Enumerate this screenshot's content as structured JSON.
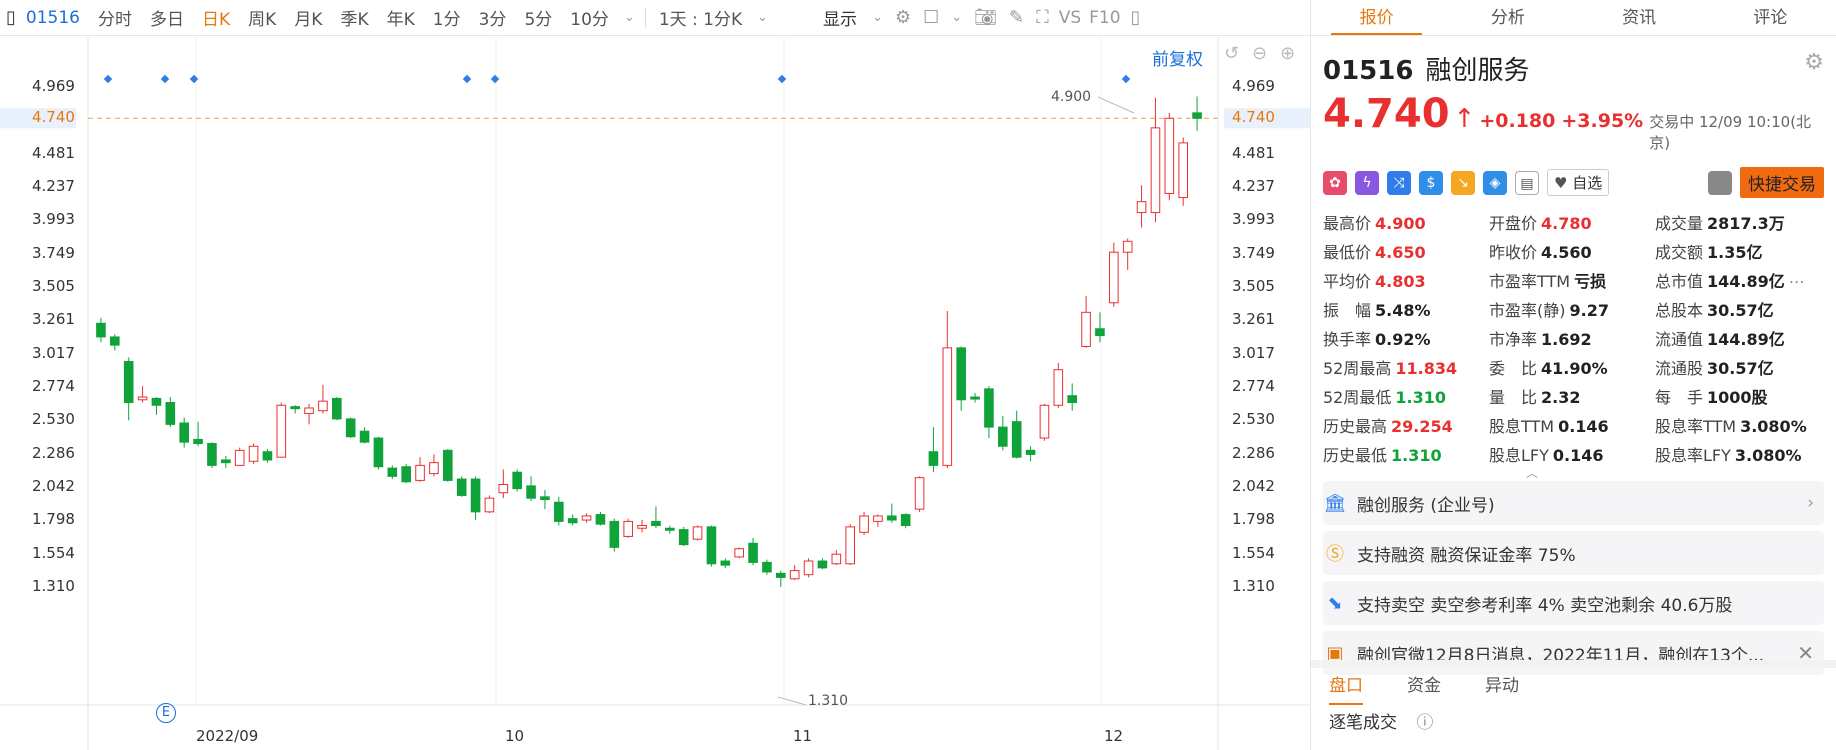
{
  "toolbar": {
    "code": "01516",
    "periods": [
      "分时",
      "多日",
      "日K",
      "周K",
      "月K",
      "季K",
      "年K",
      "1分",
      "3分",
      "5分",
      "10分"
    ],
    "active_period": "日K",
    "interval_select": "1天 : 1分K",
    "display_label": "显示",
    "vs_label": "VS",
    "f10_label": "F10"
  },
  "chart": {
    "adjust_label": "前复权",
    "current_price_label": "4.740",
    "y_ticks": [
      "4.969",
      "4.740",
      "4.481",
      "4.237",
      "3.993",
      "3.749",
      "3.505",
      "3.261",
      "3.017",
      "2.774",
      "2.530",
      "2.286",
      "2.042",
      "1.798",
      "1.554",
      "1.310"
    ],
    "x_ticks": [
      "2022/09",
      "10",
      "11",
      "12"
    ],
    "high_marker": "4.900",
    "low_marker": "1.310",
    "event_marker": "E"
  },
  "chart_data": {
    "type": "candlestick",
    "y_range": [
      1.31,
      4.969
    ],
    "candles": [
      {
        "o": 3.24,
        "c": 3.14,
        "h": 3.28,
        "l": 3.1
      },
      {
        "o": 3.14,
        "c": 3.08,
        "h": 3.16,
        "l": 3.04
      },
      {
        "o": 2.96,
        "c": 2.66,
        "h": 2.99,
        "l": 2.53
      },
      {
        "o": 2.68,
        "c": 2.7,
        "h": 2.78,
        "l": 2.66
      },
      {
        "o": 2.69,
        "c": 2.64,
        "h": 2.7,
        "l": 2.57
      },
      {
        "o": 2.66,
        "c": 2.5,
        "h": 2.7,
        "l": 2.48
      },
      {
        "o": 2.51,
        "c": 2.37,
        "h": 2.55,
        "l": 2.33
      },
      {
        "o": 2.39,
        "c": 2.36,
        "h": 2.52,
        "l": 2.34
      },
      {
        "o": 2.36,
        "c": 2.2,
        "h": 2.37,
        "l": 2.18
      },
      {
        "o": 2.24,
        "c": 2.22,
        "h": 2.27,
        "l": 2.18
      },
      {
        "o": 2.2,
        "c": 2.31,
        "h": 2.33,
        "l": 2.2
      },
      {
        "o": 2.23,
        "c": 2.34,
        "h": 2.36,
        "l": 2.21
      },
      {
        "o": 2.3,
        "c": 2.24,
        "h": 2.32,
        "l": 2.22
      },
      {
        "o": 2.26,
        "c": 2.64,
        "h": 2.66,
        "l": 2.26
      },
      {
        "o": 2.63,
        "c": 2.62,
        "h": 2.64,
        "l": 2.58
      },
      {
        "o": 2.58,
        "c": 2.62,
        "h": 2.65,
        "l": 2.5
      },
      {
        "o": 2.6,
        "c": 2.67,
        "h": 2.79,
        "l": 2.58
      },
      {
        "o": 2.69,
        "c": 2.54,
        "h": 2.7,
        "l": 2.53
      },
      {
        "o": 2.54,
        "c": 2.41,
        "h": 2.55,
        "l": 2.4
      },
      {
        "o": 2.45,
        "c": 2.37,
        "h": 2.48,
        "l": 2.36
      },
      {
        "o": 2.4,
        "c": 2.19,
        "h": 2.41,
        "l": 2.17
      },
      {
        "o": 2.18,
        "c": 2.12,
        "h": 2.2,
        "l": 2.1
      },
      {
        "o": 2.19,
        "c": 2.08,
        "h": 2.21,
        "l": 2.07
      },
      {
        "o": 2.09,
        "c": 2.2,
        "h": 2.26,
        "l": 2.08
      },
      {
        "o": 2.14,
        "c": 2.22,
        "h": 2.28,
        "l": 2.12
      },
      {
        "o": 2.31,
        "c": 2.09,
        "h": 2.32,
        "l": 2.08
      },
      {
        "o": 2.1,
        "c": 1.98,
        "h": 2.12,
        "l": 1.97
      },
      {
        "o": 2.1,
        "c": 1.86,
        "h": 2.12,
        "l": 1.8
      },
      {
        "o": 1.86,
        "c": 1.96,
        "h": 1.98,
        "l": 1.85
      },
      {
        "o": 2.0,
        "c": 2.06,
        "h": 2.17,
        "l": 1.96
      },
      {
        "o": 2.15,
        "c": 2.03,
        "h": 2.17,
        "l": 2.01
      },
      {
        "o": 2.05,
        "c": 1.96,
        "h": 2.12,
        "l": 1.94
      },
      {
        "o": 1.97,
        "c": 1.95,
        "h": 2.02,
        "l": 1.88
      },
      {
        "o": 1.93,
        "c": 1.79,
        "h": 1.97,
        "l": 1.76
      },
      {
        "o": 1.81,
        "c": 1.78,
        "h": 1.84,
        "l": 1.76
      },
      {
        "o": 1.8,
        "c": 1.83,
        "h": 1.85,
        "l": 1.78
      },
      {
        "o": 1.84,
        "c": 1.77,
        "h": 1.86,
        "l": 1.76
      },
      {
        "o": 1.79,
        "c": 1.6,
        "h": 1.81,
        "l": 1.57
      },
      {
        "o": 1.68,
        "c": 1.79,
        "h": 1.81,
        "l": 1.67
      },
      {
        "o": 1.74,
        "c": 1.76,
        "h": 1.8,
        "l": 1.71
      },
      {
        "o": 1.79,
        "c": 1.76,
        "h": 1.9,
        "l": 1.74
      },
      {
        "o": 1.74,
        "c": 1.73,
        "h": 1.76,
        "l": 1.7
      },
      {
        "o": 1.73,
        "c": 1.62,
        "h": 1.75,
        "l": 1.61
      },
      {
        "o": 1.66,
        "c": 1.75,
        "h": 1.76,
        "l": 1.65
      },
      {
        "o": 1.75,
        "c": 1.48,
        "h": 1.76,
        "l": 1.46
      },
      {
        "o": 1.5,
        "c": 1.47,
        "h": 1.52,
        "l": 1.45
      },
      {
        "o": 1.53,
        "c": 1.59,
        "h": 1.6,
        "l": 1.52
      },
      {
        "o": 1.63,
        "c": 1.49,
        "h": 1.67,
        "l": 1.47
      },
      {
        "o": 1.49,
        "c": 1.42,
        "h": 1.51,
        "l": 1.4
      },
      {
        "o": 1.41,
        "c": 1.38,
        "h": 1.43,
        "l": 1.31
      },
      {
        "o": 1.37,
        "c": 1.43,
        "h": 1.47,
        "l": 1.36
      },
      {
        "o": 1.4,
        "c": 1.5,
        "h": 1.52,
        "l": 1.38
      },
      {
        "o": 1.5,
        "c": 1.45,
        "h": 1.52,
        "l": 1.44
      },
      {
        "o": 1.48,
        "c": 1.55,
        "h": 1.58,
        "l": 1.47
      },
      {
        "o": 1.48,
        "c": 1.75,
        "h": 1.77,
        "l": 1.47
      },
      {
        "o": 1.71,
        "c": 1.83,
        "h": 1.86,
        "l": 1.69
      },
      {
        "o": 1.79,
        "c": 1.83,
        "h": 1.84,
        "l": 1.75
      },
      {
        "o": 1.83,
        "c": 1.8,
        "h": 1.92,
        "l": 1.78
      },
      {
        "o": 1.84,
        "c": 1.76,
        "h": 1.85,
        "l": 1.74
      },
      {
        "o": 1.88,
        "c": 2.11,
        "h": 2.12,
        "l": 1.86
      },
      {
        "o": 2.3,
        "c": 2.2,
        "h": 2.48,
        "l": 2.15
      },
      {
        "o": 2.2,
        "c": 3.06,
        "h": 3.33,
        "l": 2.18
      },
      {
        "o": 3.06,
        "c": 2.68,
        "h": 3.07,
        "l": 2.6
      },
      {
        "o": 2.7,
        "c": 2.69,
        "h": 2.73,
        "l": 2.66
      },
      {
        "o": 2.76,
        "c": 2.48,
        "h": 2.78,
        "l": 2.4
      },
      {
        "o": 2.48,
        "c": 2.34,
        "h": 2.56,
        "l": 2.31
      },
      {
        "o": 2.52,
        "c": 2.26,
        "h": 2.6,
        "l": 2.25
      },
      {
        "o": 2.31,
        "c": 2.28,
        "h": 2.34,
        "l": 2.23
      },
      {
        "o": 2.4,
        "c": 2.64,
        "h": 2.65,
        "l": 2.38
      },
      {
        "o": 2.64,
        "c": 2.9,
        "h": 2.95,
        "l": 2.62
      },
      {
        "o": 2.71,
        "c": 2.66,
        "h": 2.8,
        "l": 2.6
      },
      {
        "o": 3.07,
        "c": 3.32,
        "h": 3.44,
        "l": 3.06
      },
      {
        "o": 3.2,
        "c": 3.15,
        "h": 3.32,
        "l": 3.1
      },
      {
        "o": 3.39,
        "c": 3.76,
        "h": 3.83,
        "l": 3.36
      },
      {
        "o": 3.76,
        "c": 3.84,
        "h": 3.86,
        "l": 3.63
      },
      {
        "o": 4.05,
        "c": 4.13,
        "h": 4.25,
        "l": 3.94
      },
      {
        "o": 4.05,
        "c": 4.67,
        "h": 4.89,
        "l": 3.98
      },
      {
        "o": 4.19,
        "c": 4.74,
        "h": 4.78,
        "l": 4.14
      },
      {
        "o": 4.16,
        "c": 4.56,
        "h": 4.6,
        "l": 4.1
      },
      {
        "o": 4.78,
        "c": 4.74,
        "h": 4.9,
        "l": 4.65
      }
    ]
  },
  "tabs": [
    "报价",
    "分析",
    "资讯",
    "评论"
  ],
  "active_tab": "报价",
  "quote": {
    "code": "01516",
    "name": "融创服务",
    "price": "4.740",
    "change": "+0.180",
    "change_pct": "+3.95%",
    "status": "交易中 12/09 10:10(北京)",
    "watch_label": "自选",
    "fast_trade_label": "快捷交易"
  },
  "stats": [
    {
      "k": "最高价",
      "v": "4.900",
      "c": "red"
    },
    {
      "k": "开盘价",
      "v": "4.780",
      "c": "red"
    },
    {
      "k": "成交量",
      "v": "2817.3万",
      "c": ""
    },
    {
      "k": "最低价",
      "v": "4.650",
      "c": "red"
    },
    {
      "k": "昨收价",
      "v": "4.560",
      "c": ""
    },
    {
      "k": "成交额",
      "v": "1.35亿",
      "c": ""
    },
    {
      "k": "平均价",
      "v": "4.803",
      "c": "red"
    },
    {
      "k": "市盈率TTM",
      "v": "亏损",
      "c": ""
    },
    {
      "k": "总市值",
      "v": "144.89亿",
      "c": ""
    },
    {
      "k": "振　幅",
      "v": "5.48%",
      "c": ""
    },
    {
      "k": "市盈率(静)",
      "v": "9.27",
      "c": ""
    },
    {
      "k": "总股本",
      "v": "30.57亿",
      "c": ""
    },
    {
      "k": "换手率",
      "v": "0.92%",
      "c": ""
    },
    {
      "k": "市净率",
      "v": "1.692",
      "c": ""
    },
    {
      "k": "流通值",
      "v": "144.89亿",
      "c": ""
    },
    {
      "k": "52周最高",
      "v": "11.834",
      "c": "red"
    },
    {
      "k": "委　比",
      "v": "41.90%",
      "c": ""
    },
    {
      "k": "流通股",
      "v": "30.57亿",
      "c": ""
    },
    {
      "k": "52周最低",
      "v": "1.310",
      "c": "grn"
    },
    {
      "k": "量　比",
      "v": "2.32",
      "c": ""
    },
    {
      "k": "每　手",
      "v": "1000股",
      "c": ""
    },
    {
      "k": "历史最高",
      "v": "29.254",
      "c": "red"
    },
    {
      "k": "股息TTM",
      "v": "0.146",
      "c": ""
    },
    {
      "k": "股息率TTM",
      "v": "3.080%",
      "c": ""
    },
    {
      "k": "历史最低",
      "v": "1.310",
      "c": "grn"
    },
    {
      "k": "股息LFY",
      "v": "0.146",
      "c": ""
    },
    {
      "k": "股息率LFY",
      "v": "3.080%",
      "c": ""
    }
  ],
  "info": {
    "company": "融创服务 (企业号)",
    "margin": "支持融资 融资保证金率 75%",
    "short": "支持卖空 卖空参考利率 4% 卖空池剩余 40.6万股",
    "news": "融创官微12月8日消息，2022年11月，融创在13个..."
  },
  "bottom_tabs": [
    "盘口",
    "资金",
    "异动"
  ],
  "tick_title": "逐笔成交"
}
